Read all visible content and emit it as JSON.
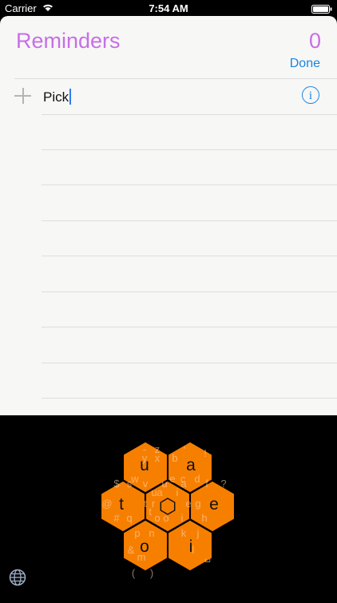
{
  "status": {
    "carrier": "Carrier",
    "time": "7:54 AM"
  },
  "list": {
    "title": "Reminders",
    "count": "0",
    "done_label": "Done",
    "item_text": "Pick"
  },
  "keyboard": {
    "accent": "#f77f00",
    "cells": [
      {
        "name": "ua",
        "main": "u",
        "subs": [
          "z",
          "y",
          "x"
        ]
      },
      {
        "name": "a",
        "main": "a",
        "subs": [
          "'",
          "b",
          "!",
          "c",
          "d"
        ]
      },
      {
        "name": "t",
        "main": "t",
        "subs": [
          "$",
          "s",
          "@",
          "r",
          "#",
          "q"
        ]
      },
      {
        "name": "center",
        "main": "",
        "subs": [
          "u",
          "a",
          "t",
          "e",
          "o",
          "i"
        ]
      },
      {
        "name": "e",
        "main": "e",
        "subs": [
          "f",
          "?",
          "g",
          "h"
        ]
      },
      {
        "name": "o",
        "main": "o",
        "subs": [
          "p",
          "n",
          "&",
          "m",
          "(",
          ")"
        ]
      },
      {
        "name": "i",
        "main": "i",
        "subs": [
          "k",
          "j",
          "l",
          "␣"
        ]
      }
    ],
    "sub_labels": [
      "-",
      "z",
      "y",
      "x",
      "'",
      "b",
      "!",
      "w",
      "c",
      "d",
      "$",
      "s",
      "v",
      "u",
      "a",
      "f",
      "?",
      "@",
      "t",
      "r",
      "e",
      "g",
      "#",
      "q",
      "o",
      "i",
      "h",
      "p",
      "n",
      "k",
      "j",
      "&",
      "m",
      "l",
      "␣",
      "(",
      ")",
      "o",
      "i",
      "e",
      "a",
      "u",
      "t"
    ]
  }
}
